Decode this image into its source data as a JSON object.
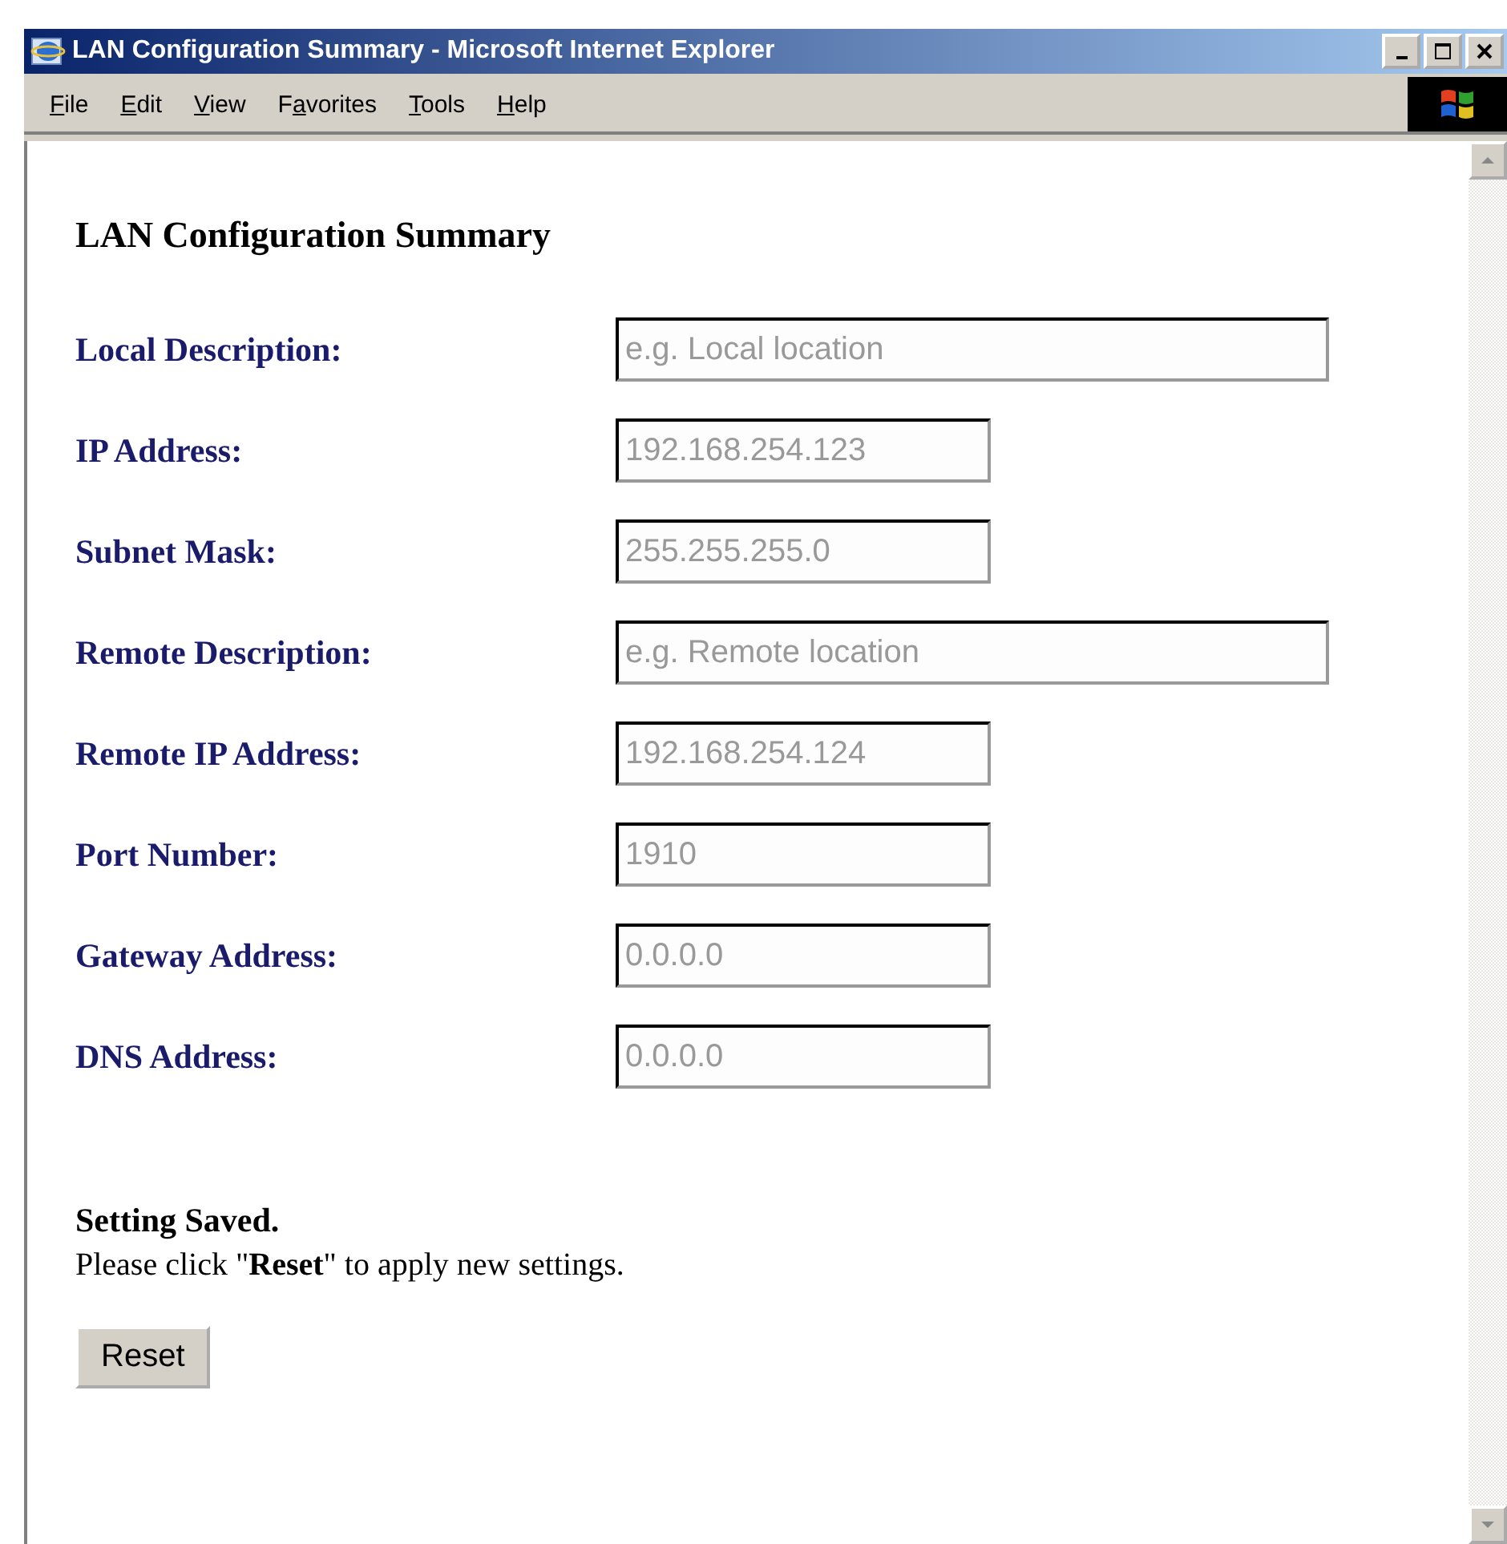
{
  "window": {
    "title": "LAN Configuration Summary - Microsoft Internet Explorer"
  },
  "menu": [
    {
      "accel": "F",
      "after": "ile"
    },
    {
      "accel": "E",
      "after": "dit"
    },
    {
      "accel": "V",
      "after": "iew"
    },
    {
      "before": "F",
      "accel": "a",
      "after": "vorites"
    },
    {
      "accel": "T",
      "after": "ools"
    },
    {
      "accel": "H",
      "after": "elp"
    }
  ],
  "page": {
    "heading": "LAN Configuration Summary",
    "fields": [
      {
        "label": "Local Description:",
        "placeholder": "e.g. Local location",
        "kind": "wide",
        "disabled": true
      },
      {
        "label": "IP Address:",
        "value": "192.168.254.123",
        "kind": "narrow",
        "disabled": true
      },
      {
        "label": "Subnet Mask:",
        "value": "255.255.255.0",
        "kind": "narrow",
        "disabled": true
      },
      {
        "label": "Remote Description:",
        "placeholder": "e.g. Remote location",
        "kind": "wide",
        "disabled": true
      },
      {
        "label": "Remote IP Address:",
        "value": "192.168.254.124",
        "kind": "narrow",
        "disabled": true
      },
      {
        "label": "Port Number:",
        "value": "1910",
        "kind": "narrow",
        "disabled": true
      },
      {
        "label": "Gateway Address:",
        "value": "0.0.0.0",
        "kind": "narrow",
        "disabled": true
      },
      {
        "label": "DNS Address:",
        "value": "0.0.0.0",
        "kind": "narrow",
        "disabled": true
      }
    ],
    "status": "Setting Saved.",
    "instruction": "Please click \"**Reset**\" to apply new settings.",
    "button": "Reset"
  }
}
